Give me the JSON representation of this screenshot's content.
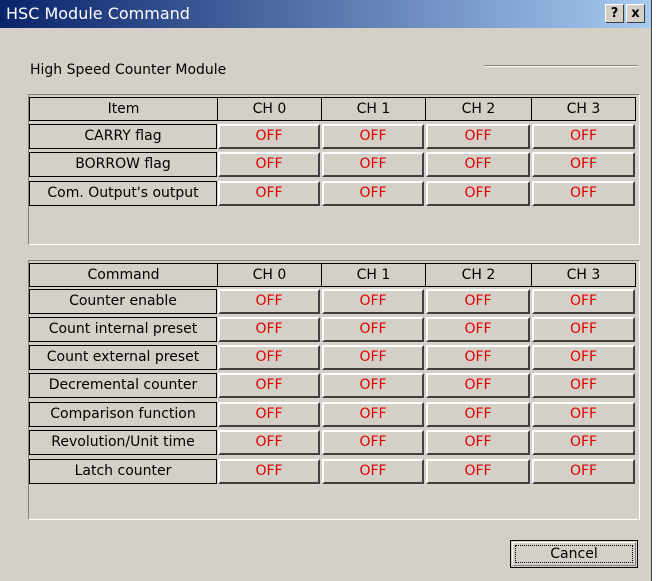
{
  "window": {
    "title": "HSC Module Command",
    "help_label": "?",
    "close_label": "x"
  },
  "group_title": "High Speed Counter Module",
  "status_table": {
    "header": [
      "Item",
      "CH 0",
      "CH 1",
      "CH 2",
      "CH 3"
    ],
    "rows": [
      {
        "label": "CARRY flag",
        "values": [
          "OFF",
          "OFF",
          "OFF",
          "OFF"
        ]
      },
      {
        "label": "BORROW flag",
        "values": [
          "OFF",
          "OFF",
          "OFF",
          "OFF"
        ]
      },
      {
        "label": "Com. Output's output",
        "values": [
          "OFF",
          "OFF",
          "OFF",
          "OFF"
        ]
      }
    ]
  },
  "command_table": {
    "header": [
      "Command",
      "CH 0",
      "CH 1",
      "CH 2",
      "CH 3"
    ],
    "rows": [
      {
        "label": "Counter enable",
        "values": [
          "OFF",
          "OFF",
          "OFF",
          "OFF"
        ]
      },
      {
        "label": "Count internal preset",
        "values": [
          "OFF",
          "OFF",
          "OFF",
          "OFF"
        ]
      },
      {
        "label": "Count external preset",
        "values": [
          "OFF",
          "OFF",
          "OFF",
          "OFF"
        ]
      },
      {
        "label": "Decremental counter",
        "values": [
          "OFF",
          "OFF",
          "OFF",
          "OFF"
        ]
      },
      {
        "label": "Comparison function",
        "values": [
          "OFF",
          "OFF",
          "OFF",
          "OFF"
        ]
      },
      {
        "label": "Revolution/Unit time",
        "values": [
          "OFF",
          "OFF",
          "OFF",
          "OFF"
        ]
      },
      {
        "label": "Latch counter",
        "values": [
          "OFF",
          "OFF",
          "OFF",
          "OFF"
        ]
      }
    ]
  },
  "cancel_label": "Cancel",
  "colors": {
    "title_start": "#0a246a",
    "title_end": "#a6caf0",
    "off_text": "#e00000",
    "face": "#d4d0c8"
  }
}
